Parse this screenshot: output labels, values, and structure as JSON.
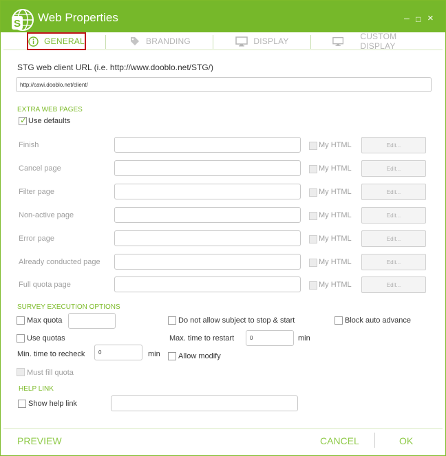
{
  "window": {
    "title": "Web Properties",
    "minimize": "–",
    "maximize": "□",
    "close": "×"
  },
  "tabs": [
    {
      "label": "GENERAL",
      "icon": "info-icon"
    },
    {
      "label": "BRANDING",
      "icon": "tag-icon"
    },
    {
      "label": "DISPLAY",
      "icon": "monitor-icon"
    },
    {
      "label": "CUSTOM DISPLAY",
      "icon": "monitor-icon"
    }
  ],
  "url": {
    "label": "STG web client URL (i.e. http://www.dooblo.net/STG/)",
    "value": "http://cawi.dooblo.net/client/"
  },
  "extra": {
    "heading": "EXTRA WEB PAGES",
    "use_defaults": "Use defaults",
    "my_html": "My HTML",
    "edit": "Edit...",
    "pages": [
      "Finish",
      "Cancel page",
      "Filter page",
      "Non-active page",
      "Error page",
      "Already conducted page",
      "Full quota page"
    ]
  },
  "exec": {
    "heading": "SURVEY EXECUTION OPTIONS",
    "max_quota": "Max quota",
    "use_quotas": "Use quotas",
    "min_recheck": "Min. time to recheck",
    "min_recheck_value": "0",
    "min_unit": "min",
    "must_fill": "Must fill quota",
    "no_stop": "Do not allow subject to stop & start",
    "max_restart": "Max. time to restart",
    "max_restart_value": "0",
    "max_unit": "min",
    "allow_modify": "Allow modify",
    "block_advance": "Block auto advance"
  },
  "help": {
    "heading": "HELP LINK",
    "show": "Show help link"
  },
  "footer": {
    "preview": "PREVIEW",
    "cancel": "CANCEL",
    "ok": "OK"
  },
  "colors": {
    "accent": "#76b82a",
    "highlight": "#c0161c"
  }
}
